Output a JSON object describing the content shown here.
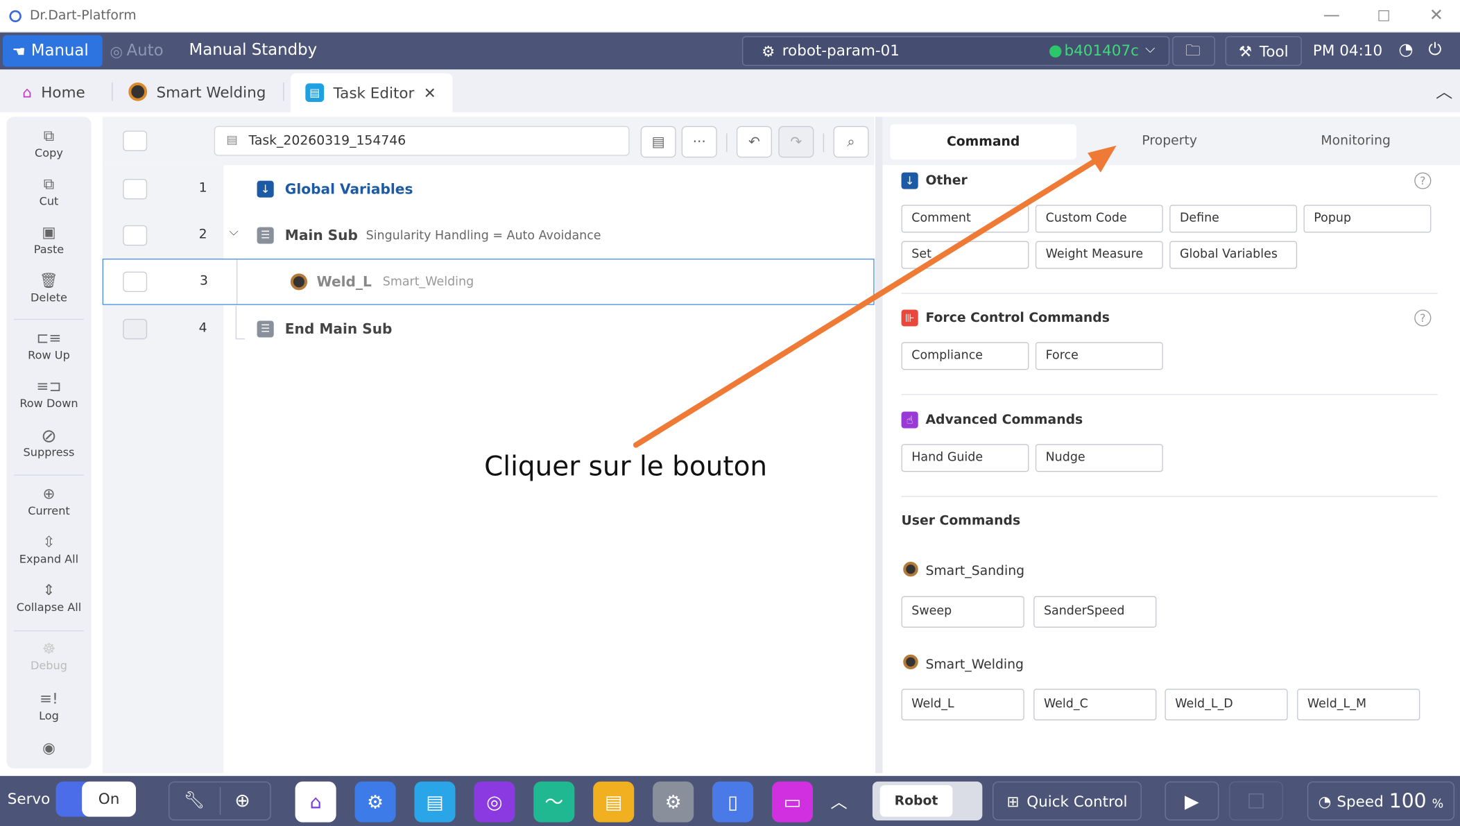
{
  "window": {
    "title": "Dr.Dart-Platform"
  },
  "topbar": {
    "mode_manual": "Manual",
    "mode_auto": "Auto",
    "mode_status": "Manual Standby",
    "robot_name": "robot-param-01",
    "robot_hash": "b401407c",
    "tool_label": "Tool",
    "clock": "PM 04:10"
  },
  "tabs": [
    {
      "label": "Home",
      "icon": "home-icon"
    },
    {
      "label": "Smart Welding",
      "icon": "welding-icon"
    },
    {
      "label": "Task Editor",
      "icon": "task-editor-icon",
      "active": true
    }
  ],
  "sidebar": {
    "items": [
      {
        "label": "Copy",
        "icon": "copy-icon"
      },
      {
        "label": "Cut",
        "icon": "cut-icon"
      },
      {
        "label": "Paste",
        "icon": "paste-icon"
      },
      {
        "label": "Delete",
        "icon": "trash-icon"
      },
      {
        "label": "Row Up",
        "icon": "row-up-icon"
      },
      {
        "label": "Row Down",
        "icon": "row-down-icon"
      },
      {
        "label": "Suppress",
        "icon": "suppress-icon"
      },
      {
        "label": "Current",
        "icon": "crosshair-icon"
      },
      {
        "label": "Expand All",
        "icon": "expand-icon"
      },
      {
        "label": "Collapse All",
        "icon": "collapse-icon"
      },
      {
        "label": "Debug",
        "icon": "bug-icon",
        "disabled": true
      },
      {
        "label": "Log",
        "icon": "log-icon"
      }
    ]
  },
  "task": {
    "name": "Task_20260319_154746",
    "rows": [
      {
        "num": "1",
        "label": "Global Variables",
        "sub": ""
      },
      {
        "num": "2",
        "label": "Main Sub",
        "sub": "Singularity Handling = Auto Avoidance"
      },
      {
        "num": "3",
        "label": "Weld_L",
        "sub": "Smart_Welding"
      },
      {
        "num": "4",
        "label": "End Main Sub",
        "sub": ""
      }
    ]
  },
  "panel": {
    "tabs": [
      "Command",
      "Property",
      "Monitoring"
    ],
    "other_title": "Other",
    "other_cmds": [
      "Comment",
      "Custom Code",
      "Define",
      "Popup",
      "Set",
      "Weight Measure",
      "Global Variables"
    ],
    "force_title": "Force Control Commands",
    "force_cmds": [
      "Compliance",
      "Force"
    ],
    "adv_title": "Advanced Commands",
    "adv_cmds": [
      "Hand Guide",
      "Nudge"
    ],
    "user_title": "User Commands",
    "sanding_name": "Smart_Sanding",
    "sanding_cmds": [
      "Sweep",
      "SanderSpeed"
    ],
    "welding_name": "Smart_Welding",
    "welding_cmds": [
      "Weld_L",
      "Weld_C",
      "Weld_L_D",
      "Weld_L_M"
    ]
  },
  "bottom": {
    "servo_label": "Servo",
    "servo_state": "On",
    "robot_label": "Robot",
    "quick_control": "Quick Control",
    "speed_label": "Speed",
    "speed_value": "100",
    "speed_unit": "%"
  },
  "annotation": {
    "text": "Cliquer sur le bouton",
    "arrow_color": "#ee7a36"
  }
}
